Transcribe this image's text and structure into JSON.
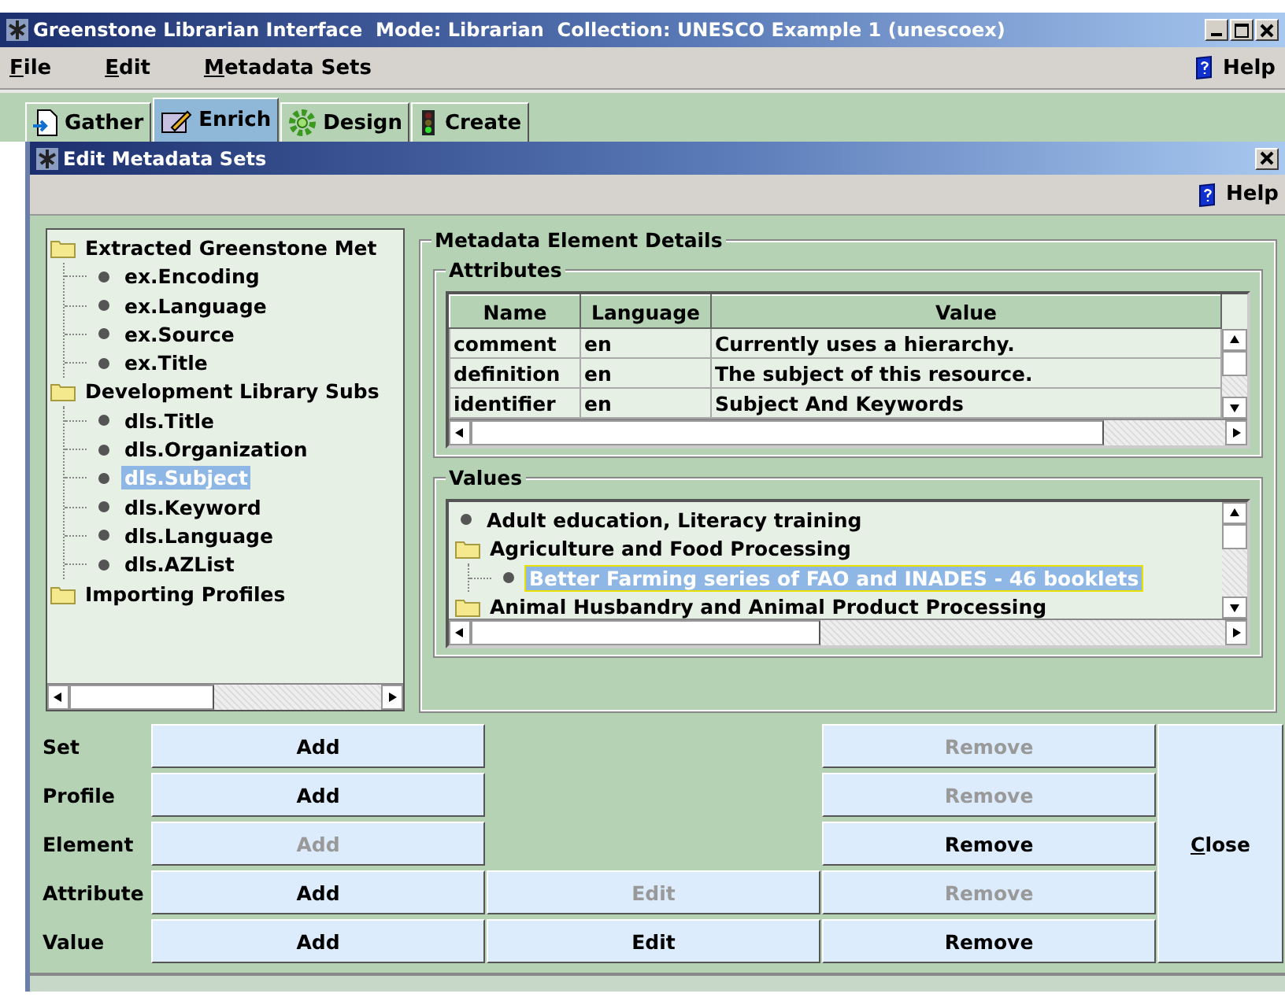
{
  "window": {
    "title": "Greenstone Librarian Interface  Mode: Librarian  Collection: UNESCO Example 1 (unescoex)"
  },
  "menu": [
    {
      "label": "File",
      "mnemonic": true
    },
    {
      "label": "Edit",
      "mnemonic": true
    },
    {
      "label": "Metadata Sets",
      "mnemonic": true
    }
  ],
  "help": {
    "label": "Help"
  },
  "tabs": [
    {
      "label": "Gather",
      "kind": "document",
      "selected": false
    },
    {
      "label": "Enrich",
      "kind": "pencil",
      "selected": true
    },
    {
      "label": "Design",
      "kind": "gear",
      "selected": false
    },
    {
      "label": "Create",
      "kind": "lights",
      "selected": false
    }
  ],
  "dialog": {
    "title": "Edit Metadata Sets",
    "help": "Help"
  },
  "tree": [
    {
      "label": "Extracted Greenstone Met",
      "kind": "folder",
      "selected": false,
      "children": [
        {
          "label": "ex.Encoding",
          "kind": "leaf",
          "selected": false
        },
        {
          "label": "ex.Language",
          "kind": "leaf",
          "selected": false
        },
        {
          "label": "ex.Source",
          "kind": "leaf",
          "selected": false
        },
        {
          "label": "ex.Title",
          "kind": "leaf",
          "selected": false
        }
      ]
    },
    {
      "label": "Development Library Subs",
      "kind": "folder",
      "selected": false,
      "children": [
        {
          "label": "dls.Title",
          "kind": "leaf",
          "selected": false
        },
        {
          "label": "dls.Organization",
          "kind": "leaf",
          "selected": false
        },
        {
          "label": "dls.Subject",
          "kind": "leaf",
          "selected": true
        },
        {
          "label": "dls.Keyword",
          "kind": "leaf",
          "selected": false
        },
        {
          "label": "dls.Language",
          "kind": "leaf",
          "selected": false
        },
        {
          "label": "dls.AZList",
          "kind": "leaf",
          "selected": false
        }
      ]
    },
    {
      "label": "Importing Profiles",
      "kind": "folder",
      "selected": false
    }
  ],
  "details": {
    "title": "Metadata Element Details",
    "attributes_title": "Attributes",
    "values_title": "Values"
  },
  "table": {
    "columns": [
      "Name",
      "Language",
      "Value"
    ],
    "rows": [
      [
        "comment",
        "en",
        "Currently uses a hierarchy."
      ],
      [
        "definition",
        "en",
        "The subject of this resource."
      ],
      [
        "identifier",
        "en",
        "Subject And Keywords"
      ]
    ]
  },
  "values": [
    {
      "label": "Adult education, Literacy training",
      "kind": "leaf",
      "selected": false
    },
    {
      "label": "Agriculture and Food Processing",
      "kind": "folder",
      "selected": false,
      "children": [
        {
          "label": "Better Farming series of FAO and INADES - 46 booklets",
          "kind": "leaf",
          "selected": true
        }
      ]
    },
    {
      "label": "Animal Husbandry and Animal Product Processing",
      "kind": "folder",
      "selected": false
    }
  ],
  "actions": [
    {
      "label": "Set",
      "add": {
        "label": "Add",
        "disabled": false
      },
      "remove": {
        "label": "Remove",
        "disabled": true
      }
    },
    {
      "label": "Profile",
      "add": {
        "label": "Add",
        "disabled": false
      },
      "remove": {
        "label": "Remove",
        "disabled": true
      }
    },
    {
      "label": "Element",
      "add": {
        "label": "Add",
        "disabled": true
      },
      "remove": {
        "label": "Remove",
        "disabled": false
      }
    },
    {
      "label": "Attribute",
      "add": {
        "label": "Add",
        "disabled": false
      },
      "edit": {
        "label": "Edit",
        "disabled": true
      },
      "remove": {
        "label": "Remove",
        "disabled": true
      }
    },
    {
      "label": "Value",
      "add": {
        "label": "Add",
        "disabled": false
      },
      "edit": {
        "label": "Edit",
        "disabled": false
      },
      "remove": {
        "label": "Remove",
        "disabled": false
      }
    }
  ],
  "close": {
    "label": "Close",
    "mnemonic": true
  }
}
